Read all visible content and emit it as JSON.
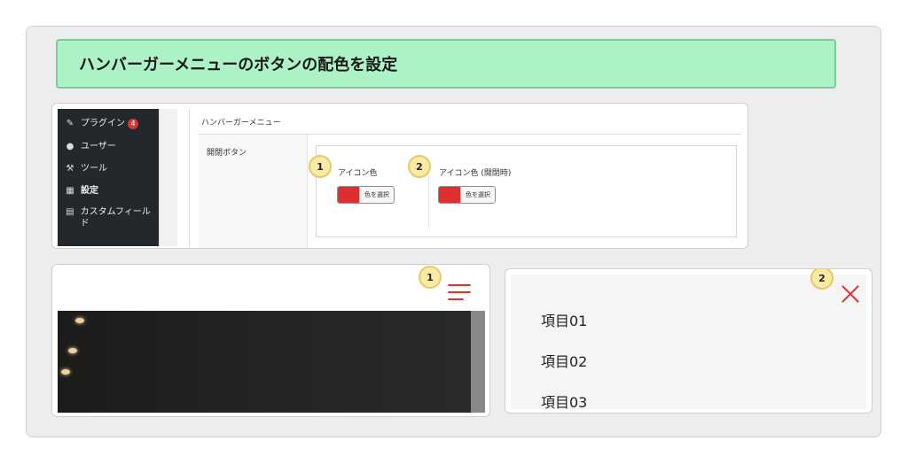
{
  "banner": {
    "title": "ハンバーガーメニューのボタンの配色を設定"
  },
  "admin": {
    "sidebar": [
      {
        "icon": "plugin-icon",
        "label": "プラグイン",
        "badge": "4"
      },
      {
        "icon": "user-icon",
        "label": "ユーザー"
      },
      {
        "icon": "wrench-icon",
        "label": "ツール"
      },
      {
        "icon": "settings-icon",
        "label": "設定"
      },
      {
        "icon": "custom-field-icon",
        "label": "カスタムフィールド"
      }
    ],
    "section_title": "ハンバーガーメニュー",
    "row_label": "開閉ボタン",
    "options": [
      {
        "number": "1",
        "label": "アイコン色",
        "button": "色を選択",
        "color": "#dd2f2f"
      },
      {
        "number": "2",
        "label": "アイコン色 (開閉時)",
        "button": "色を選択",
        "color": "#dd2f2f"
      }
    ]
  },
  "preview_closed": {
    "number": "1",
    "icon": "hamburger-icon",
    "icon_color": "#e03131"
  },
  "preview_open": {
    "number": "2",
    "icon": "close-icon",
    "icon_color": "#e03131",
    "items": [
      "項目01",
      "項目02",
      "項目03"
    ]
  }
}
